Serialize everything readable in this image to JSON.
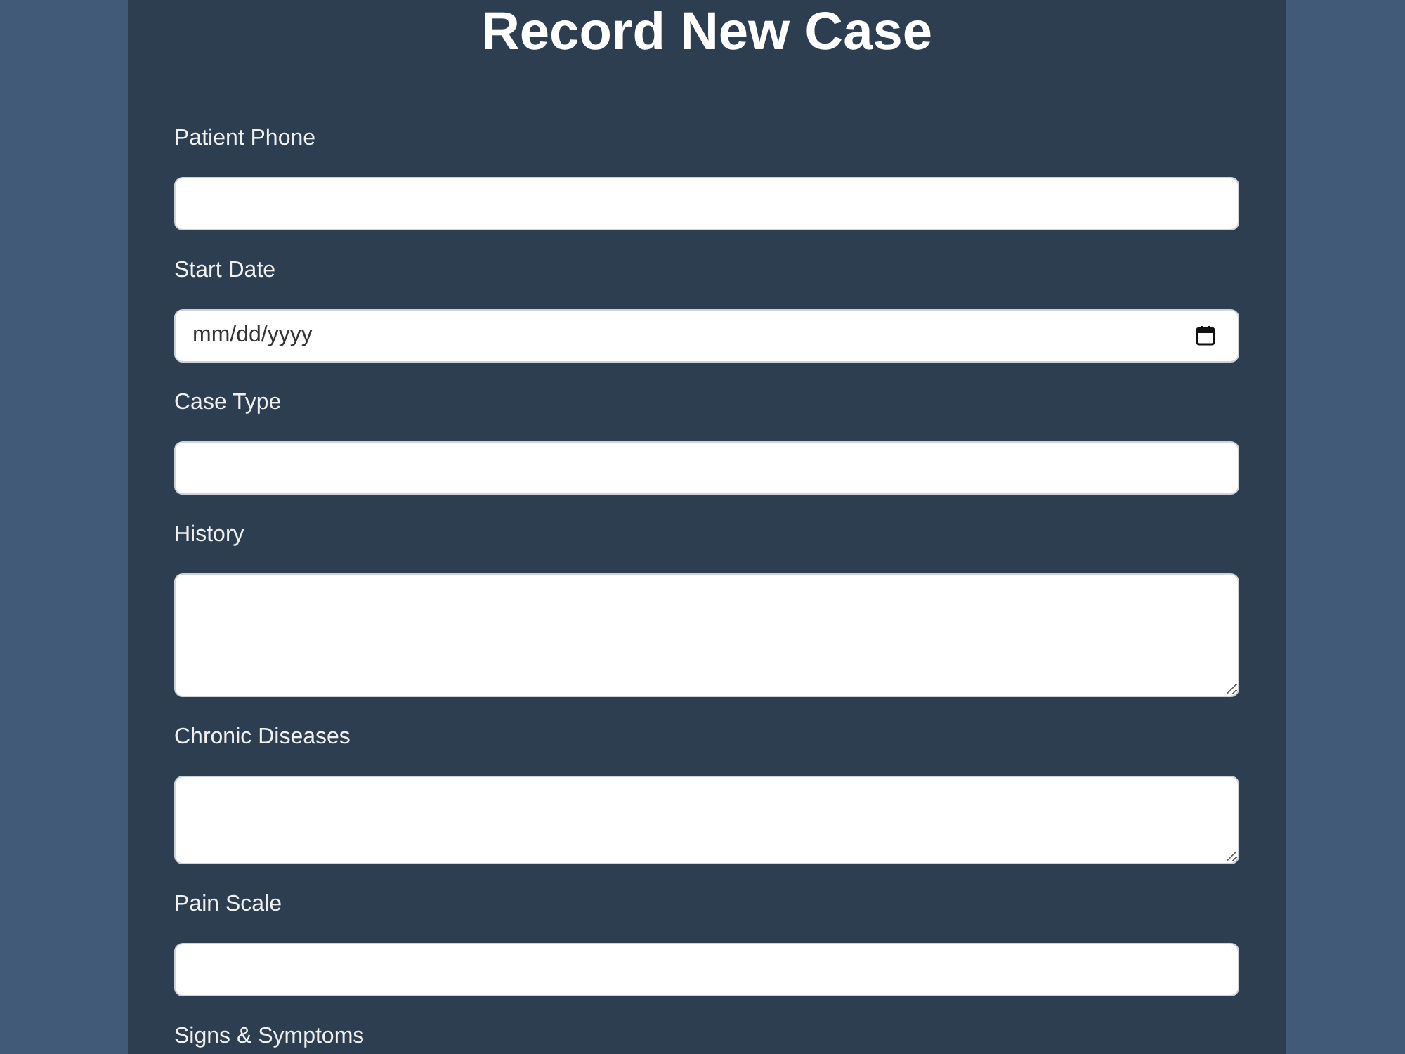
{
  "title": "Record New Case",
  "fields": [
    {
      "label": "Patient Phone",
      "input": {
        "kind": "text"
      }
    },
    {
      "label": "Start Date",
      "input": {
        "kind": "date",
        "placeholder": "mm/dd/yyyy"
      }
    },
    {
      "label": "Case Type",
      "input": {
        "kind": "text"
      }
    },
    {
      "label": "History",
      "input": {
        "kind": "textarea"
      }
    },
    {
      "label": "Chronic Diseases",
      "input": {
        "kind": "textarea"
      }
    },
    {
      "label": "Pain Scale",
      "input": {
        "kind": "text"
      }
    },
    {
      "label": "Signs & Symptoms"
    }
  ]
}
